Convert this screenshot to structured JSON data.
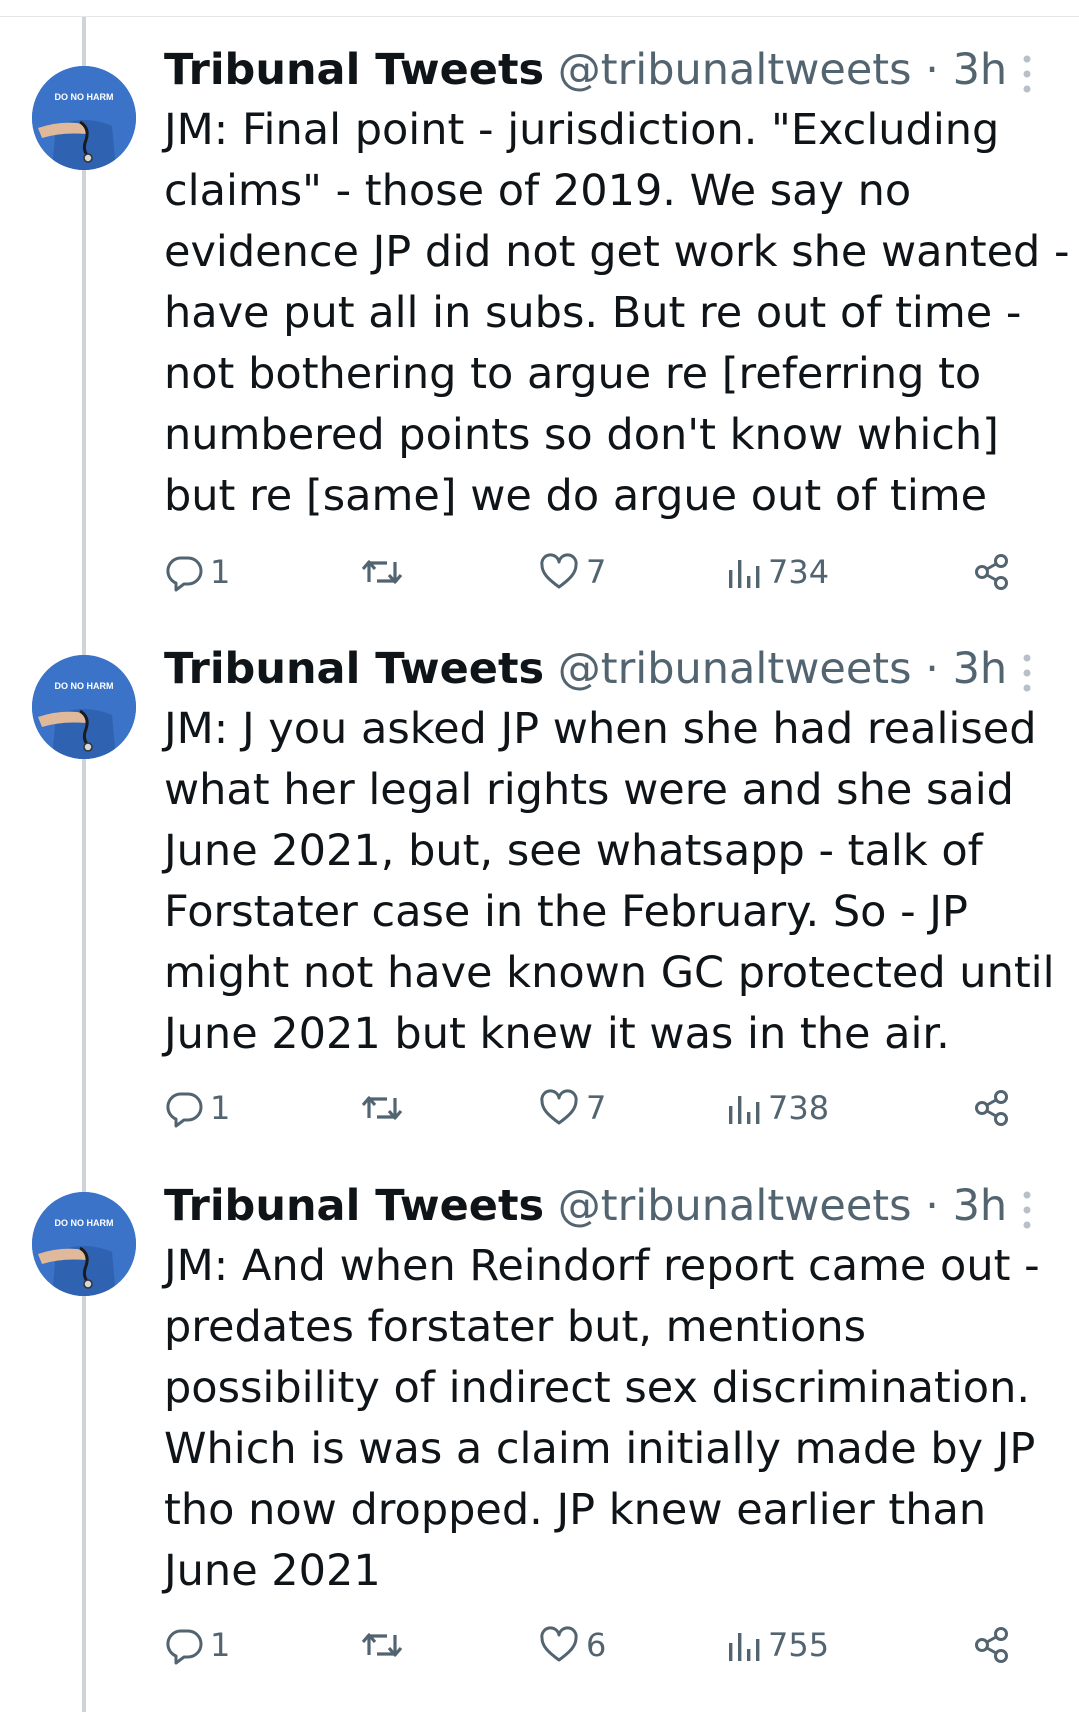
{
  "tweets": [
    {
      "author_name": "Tribunal Tweets",
      "handle": "@tribunaltweets",
      "separator": "·",
      "time": "3h",
      "avatar_text": "DO NO HARM",
      "lines": [
        "JM: Final point - jurisdiction. \"Excluding",
        "claims\" - those of 2019. We say no",
        "evidence JP did not get work she wanted -",
        "have put all in subs. But re out of time -",
        "not bothering to argue re [referring to",
        "numbered points so don't know which]",
        "but re [same] we do argue out of time"
      ],
      "replies": "1",
      "likes": "7",
      "views": "734"
    },
    {
      "author_name": "Tribunal Tweets",
      "handle": "@tribunaltweets",
      "separator": "·",
      "time": "3h",
      "avatar_text": "DO NO HARM",
      "lines": [
        "JM: J you asked JP when she had realised",
        "what her legal rights were and she said",
        "June 2021, but, see whatsapp - talk of",
        "Forstater case in the February. So - JP",
        "might not have known GC protected until",
        "June 2021 but knew it was in the air."
      ],
      "replies": "1",
      "likes": "7",
      "views": "738"
    },
    {
      "author_name": "Tribunal Tweets",
      "handle": "@tribunaltweets",
      "separator": "·",
      "time": "3h",
      "avatar_text": "DO NO HARM",
      "lines": [
        "JM: And when Reindorf report came out -",
        "predates forstater but, mentions",
        "possibility of indirect sex discrimination.",
        "Which is was a claim initially made by JP",
        "tho now dropped. JP knew earlier than",
        "June 2021"
      ],
      "replies": "1",
      "likes": "6",
      "views": "755"
    }
  ],
  "icons": {
    "reply": "reply-icon",
    "retweet": "retweet-icon",
    "like": "heart-icon",
    "views": "views-icon",
    "share": "share-icon",
    "more": "more-vertical-icon"
  },
  "colors": {
    "text": "#0f1419",
    "secondary": "#536471",
    "thread_line": "#d0d4d8",
    "avatar_bg": "#3a73c8"
  }
}
